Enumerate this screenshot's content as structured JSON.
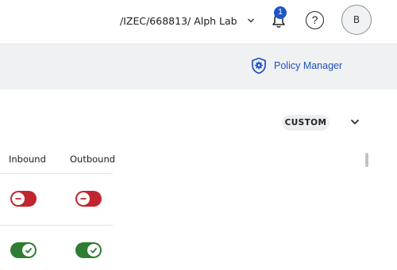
{
  "header": {
    "org_path": "/IZEC/668813/ Alph Lab",
    "notifications_count": "1",
    "help_symbol": "?",
    "avatar_initial": "B",
    "org_chevron_icon": "chevron-down-icon",
    "bell_icon": "bell-icon",
    "help_icon": "question-circle-icon"
  },
  "subheader": {
    "policy_manager_label": "Policy Manager",
    "policy_manager_icon": "shield-gear-icon",
    "link_color": "#1f4fbf"
  },
  "rule": {
    "badge": "CUSTOM",
    "expand_icon": "chevron-down-icon"
  },
  "table": {
    "columns": [
      "Inbound",
      "Outbound"
    ],
    "rows": [
      {
        "inbound": false,
        "outbound": false
      },
      {
        "inbound": true,
        "outbound": true
      }
    ]
  },
  "colors": {
    "toggle_off": "#c0262f",
    "toggle_on": "#2e7d32",
    "badge_blue": "#1f56c8"
  }
}
